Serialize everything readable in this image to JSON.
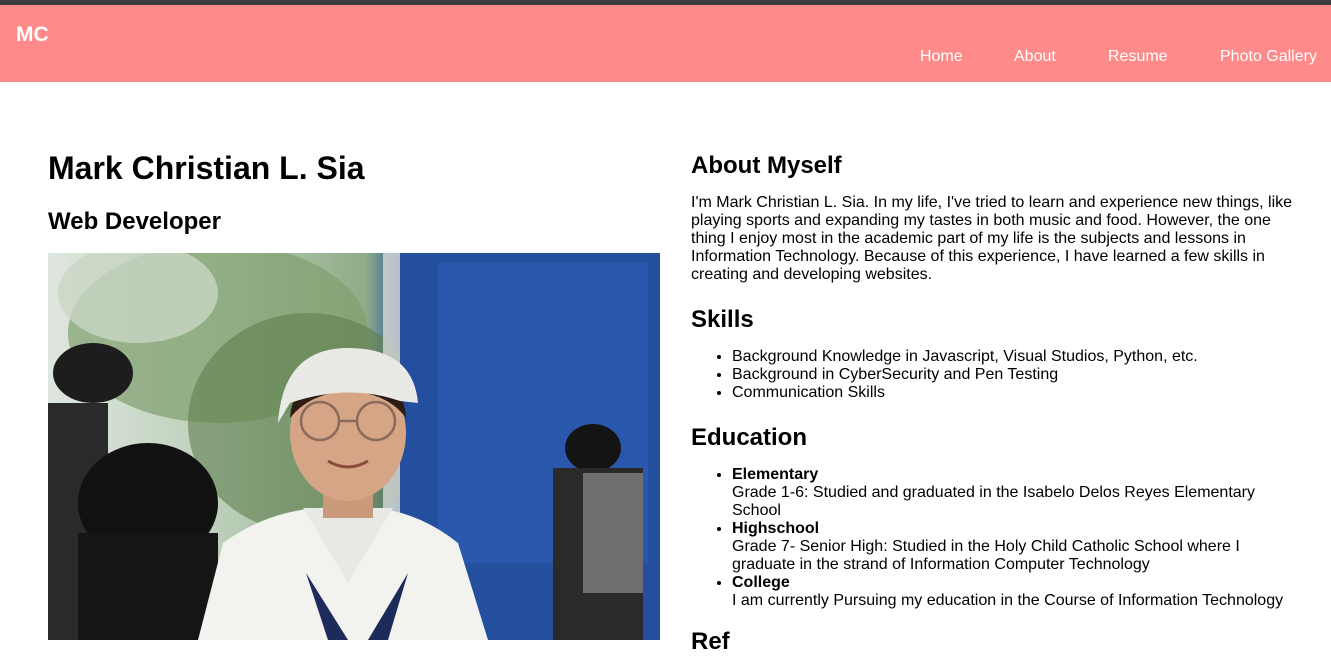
{
  "nav": {
    "logo": "MC",
    "links": [
      "Home",
      "About",
      "Resume",
      "Photo Gallery"
    ]
  },
  "profile": {
    "name": "Mark Christian L. Sia",
    "role": "Web Developer",
    "photo_icon": "portrait-photo"
  },
  "about": {
    "title": "About Myself",
    "text": "I'm Mark Christian L. Sia. In my life, I've tried to learn and experience new things, like playing sports and expanding my tastes in both music and food. However, the one thing I enjoy most in the academic part of my life is the subjects and lessons in Information Technology. Because of this experience, I have learned a few skills in creating and developing websites."
  },
  "skills": {
    "title": "Skills",
    "items": [
      "Background Knowledge in Javascript, Visual Studios, Python, etc.",
      "Background in CyberSecurity and Pen Testing",
      "Communication Skills"
    ]
  },
  "education": {
    "title": "Education",
    "items": [
      {
        "level": "Elementary",
        "detail": "Grade 1-6: Studied and graduated in the Isabelo Delos Reyes Elementary School"
      },
      {
        "level": "Highschool",
        "detail": "Grade 7- Senior High: Studied in the Holy Child Catholic School where I graduate in the strand of Information Computer Technology"
      },
      {
        "level": "College",
        "detail": "I am currently Pursuing my education in the Course of Information Technology"
      }
    ]
  },
  "next_section": {
    "title": "Ref"
  },
  "colors": {
    "navbar": "#ff8a8a",
    "topbar": "#3b3b3b",
    "text": "#000000",
    "nav_text": "#ffffff"
  }
}
